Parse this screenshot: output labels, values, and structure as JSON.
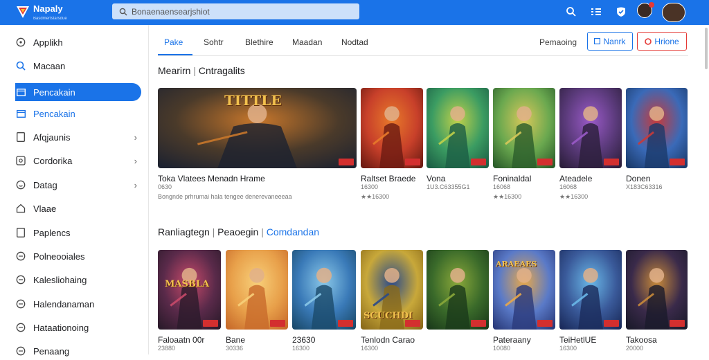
{
  "app": {
    "name": "Napaly",
    "tagline": "Basdmertstarsdue"
  },
  "search": {
    "placeholder": "Bonaenaensearjshiot"
  },
  "topbar": {
    "icons": [
      "search-icon",
      "grid-icon",
      "shield-icon",
      "notification-avatar",
      "user-avatar"
    ]
  },
  "sidebar": {
    "items": [
      {
        "label": "Applikh",
        "icon": "grid-circle-icon"
      },
      {
        "label": "Macaan",
        "icon": "search-icon"
      },
      {
        "label": "Pencakain",
        "icon": "square-icon",
        "active": true
      },
      {
        "label": "Pencakain",
        "icon": "square-icon"
      },
      {
        "label": "Afqjaunis",
        "icon": "document-icon"
      },
      {
        "label": "Cordorika",
        "icon": "settings-icon"
      },
      {
        "label": "Datag",
        "icon": "chat-icon"
      },
      {
        "label": "Vlaae",
        "icon": "home-icon"
      },
      {
        "label": "Paplencs",
        "icon": "document-icon"
      },
      {
        "label": "Polneooiales",
        "icon": "circle-icon"
      },
      {
        "label": "Kalesliohaing",
        "icon": "circle-icon"
      },
      {
        "label": "Halendanaman",
        "icon": "circle-icon"
      },
      {
        "label": "Hataationoing",
        "icon": "circle-icon"
      },
      {
        "label": "Penaang",
        "icon": "circle-icon"
      }
    ]
  },
  "tabs": [
    "Pake",
    "Sohtr",
    "Blethire",
    "Maadan",
    "Nodtad"
  ],
  "filter_label": "Pemaoing",
  "buttons": {
    "primary": "Nanrk",
    "secondary": "Hrione"
  },
  "section1": {
    "title": "Mearirn",
    "subtitle": "Cntragalits",
    "cards": [
      {
        "title": "Toka Vlatees Menadn Hrame",
        "meta1": "0630",
        "meta2": "Bongnde prhrumai hala tengee denerevaneeeaa",
        "badge": "TITTLE",
        "colors": [
          "#1d2230",
          "#4a3a2a",
          "#c8772b"
        ]
      },
      {
        "title": "Raltset Braede",
        "meta1": "16300",
        "meta2": "★★16300",
        "colors": [
          "#6b1a12",
          "#c8402a",
          "#e87a2a"
        ]
      },
      {
        "title": "Vona",
        "meta1": "1U3.C63355G1",
        "meta2": "",
        "colors": [
          "#1b5e45",
          "#3b9c62",
          "#c1d14a"
        ]
      },
      {
        "title": "Foninaldal",
        "meta1": "16068",
        "meta2": "★★16300",
        "colors": [
          "#2a5c2a",
          "#6aa84f",
          "#d8c85a"
        ]
      },
      {
        "title": "Ateadele",
        "meta1": "16068",
        "meta2": "★★16300",
        "colors": [
          "#2b1e3a",
          "#5a3a7a",
          "#9a5ac8"
        ]
      },
      {
        "title": "Donen",
        "meta1": "X183C63316",
        "meta2": "",
        "colors": [
          "#1a3a6a",
          "#3a6ab8",
          "#c83a3a"
        ]
      }
    ]
  },
  "section2": {
    "title": "Ranliagtegn",
    "subtitle": "Peaoegin",
    "link": "Comdandan",
    "cards": [
      {
        "title": "Faloaatn 00r",
        "meta1": "23880",
        "badge": "MASBLA",
        "colors": [
          "#2a1a2a",
          "#5a2a4a",
          "#c84a6a"
        ]
      },
      {
        "title": "Bane",
        "meta1": "30336",
        "colors": [
          "#c86a2a",
          "#e8a04a",
          "#f8d07a"
        ]
      },
      {
        "title": "23630",
        "meta1": "16300",
        "colors": [
          "#1a4a6a",
          "#3a7ab8",
          "#8ac8e8"
        ]
      },
      {
        "title": "Tenlodn Carao",
        "meta1": "16300",
        "badge": "SCUCHDI",
        "colors": [
          "#8a6a1a",
          "#c8a83a",
          "#2a4a8a"
        ]
      },
      {
        "title": "",
        "meta1": "",
        "colors": [
          "#1a3a1a",
          "#3a6a2a",
          "#8aa83a"
        ]
      },
      {
        "title": "Pateraany",
        "meta1": "10080",
        "badge": "ARAEAES",
        "colors": [
          "#2a3a7a",
          "#5a7ac8",
          "#e8a84a"
        ]
      },
      {
        "title": "TeiHetlUE",
        "meta1": "16300",
        "colors": [
          "#1a2a5a",
          "#3a5a9a",
          "#6ab8e8"
        ]
      },
      {
        "title": "Takoosa",
        "meta1": "20000",
        "colors": [
          "#1a1a2a",
          "#3a2a4a",
          "#c88a3a"
        ]
      }
    ]
  }
}
